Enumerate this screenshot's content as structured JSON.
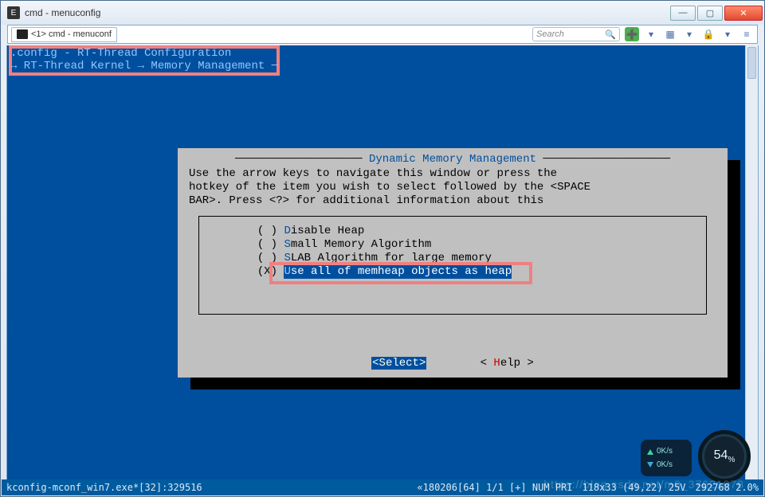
{
  "window": {
    "title": "cmd - menuconfig",
    "icon_label": "E"
  },
  "buttons": {
    "min": "—",
    "max": "▢",
    "close": "✕"
  },
  "tab": {
    "label": "<1> cmd - menuconf"
  },
  "search": {
    "placeholder": "Search",
    "magnifier": "🔍"
  },
  "toolbar": {
    "plus": "➕",
    "caret": "▾",
    "grid": "▦",
    "caret2": "▾",
    "lock": "🔒",
    "caret3": "▾",
    "bars": "≡"
  },
  "header": {
    "line1": ".config - RT-Thread Configuration",
    "line2": "→ RT-Thread Kernel → Memory Management ─"
  },
  "dialog": {
    "title": "Dynamic Memory Management",
    "instructions": "Use the arrow keys to navigate this window or press the\nhotkey of the item you wish to select followed by the <SPACE\nBAR>. Press <?> for additional information about this",
    "options": [
      {
        "marker": "( )",
        "hotkey": "D",
        "rest": "isable Heap",
        "selected": false
      },
      {
        "marker": "( )",
        "hotkey": "S",
        "rest": "mall Memory Algorithm",
        "selected": false
      },
      {
        "marker": "( )",
        "hotkey": "S",
        "rest": "LAB Algorithm for large memory",
        "selected": false
      },
      {
        "marker": "(X)",
        "hotkey": "U",
        "rest": "se all of memheap objects as heap",
        "selected": true
      }
    ],
    "btn_select_l": "<",
    "btn_select_hot": "S",
    "btn_select_r": "elect>",
    "btn_help_l": "< ",
    "btn_help_hot": "H",
    "btn_help_r": "elp >"
  },
  "status": {
    "left": "kconfig-mconf_win7.exe*[32]:329516",
    "r1": "«180206[64]  1/1  [+]  NUM  PRI",
    "r2": "118x33  (49,22) 25V",
    "r3": "292768 2.0%"
  },
  "net": {
    "up": "0K/s",
    "down": "0K/s"
  },
  "gauge": {
    "value": "54",
    "suffix": "%"
  },
  "watermark": "https://blog.csdn.net/m0_37621078"
}
